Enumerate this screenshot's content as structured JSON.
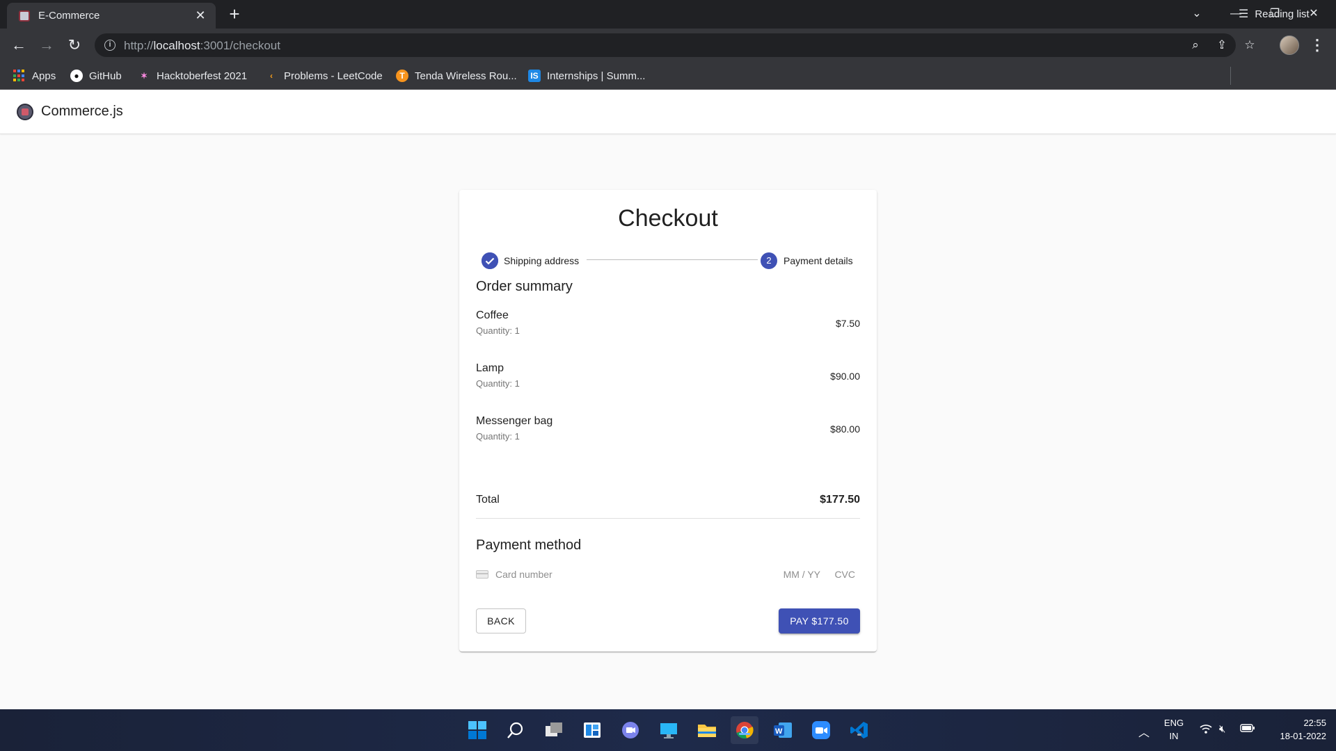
{
  "browser": {
    "tab_title": "E-Commerce",
    "url_prefix": "http://",
    "url_host": "localhost",
    "url_path": ":3001/checkout",
    "bookmarks": [
      "Apps",
      "GitHub",
      "Hacktoberfest 2021",
      "Problems - LeetCode",
      "Tenda Wireless Rou...",
      "Internships | Summ..."
    ],
    "reading_list": "Reading list"
  },
  "app": {
    "name": "Commerce.js"
  },
  "checkout": {
    "title": "Checkout",
    "steps": [
      {
        "label": "Shipping address",
        "state": "completed",
        "marker": ""
      },
      {
        "label": "Payment details",
        "state": "active",
        "marker": "2"
      }
    ],
    "order_summary_title": "Order summary",
    "items": [
      {
        "name": "Coffee",
        "quantity": "Quantity: 1",
        "price": "$7.50"
      },
      {
        "name": "Lamp",
        "quantity": "Quantity: 1",
        "price": "$90.00"
      },
      {
        "name": "Messenger bag",
        "quantity": "Quantity: 1",
        "price": "$80.00"
      }
    ],
    "total_label": "Total",
    "total_value": "$177.50",
    "payment_method_title": "Payment method",
    "card_placeholder": "Card number",
    "expiry_placeholder": "MM / YY",
    "cvc_placeholder": "CVC",
    "back_label": "BACK",
    "pay_label": "PAY $177.50"
  },
  "taskbar": {
    "language": "ENG",
    "region": "IN",
    "time": "22:55",
    "date": "18-01-2022"
  },
  "colors": {
    "primary": "#3f51b5",
    "chrome_dark": "#202124",
    "chrome_toolbar": "#35363a"
  }
}
